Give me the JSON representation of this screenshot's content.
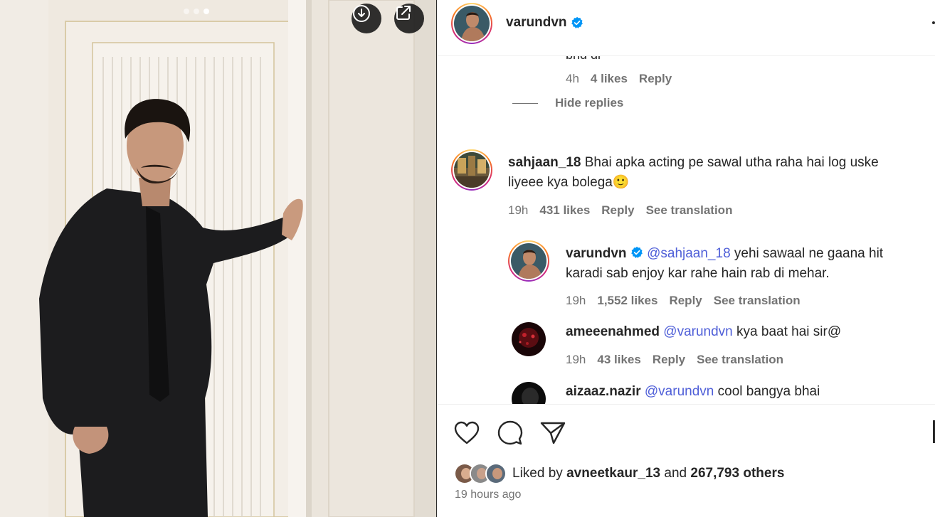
{
  "media": {
    "carousel_total": 3,
    "carousel_active": 3,
    "download_icon": "download-circle-icon",
    "open_icon": "external-link-icon"
  },
  "header": {
    "username": "varundvn",
    "verified": true
  },
  "comments": {
    "clipped_reply": {
      "text": "bhd di",
      "time": "4h",
      "likes": "4 likes",
      "reply": "Reply"
    },
    "hide_replies": "Hide replies",
    "items": [
      {
        "user": "sahjaan_18",
        "text": "Bhai apka acting pe sawal utha raha hai log uske",
        "text2": "liyeee kya bolega",
        "emoji": "🙂",
        "time": "19h",
        "likes": "431 likes",
        "reply": "Reply",
        "translate": "See translation"
      },
      {
        "user": "varundvn",
        "mention": "@sahjaan_18",
        "text": "yehi sawaal ne gaana hit",
        "text2": "karadi sab enjoy kar rahe hain rab di mehar.",
        "time": "19h",
        "likes": "1,552 likes",
        "reply": "Reply",
        "translate": "See translation"
      },
      {
        "user": "ameeenahmed",
        "mention": "@varundvn",
        "text": "kya baat hai sir@",
        "time": "19h",
        "likes": "43 likes",
        "reply": "Reply",
        "translate": "See translation"
      },
      {
        "user": "aizaaz.nazir",
        "mention": "@varundvn",
        "text": "cool bangya bhai"
      }
    ]
  },
  "actions": {
    "like_icon": "heart-icon",
    "comment_icon": "comment-icon",
    "share_icon": "send-icon",
    "bookmark_icon": "bookmark-icon",
    "liked_by_prefix": "Liked by",
    "liked_by_user": "avneetkaur_13",
    "liked_by_and": "and",
    "liked_by_others": "267,793 others",
    "time_ago": "19 hours ago"
  },
  "colors": {
    "accent_link": "#4f5fd8",
    "verified_blue": "#0095f6",
    "muted": "#737373",
    "text": "#262626"
  }
}
